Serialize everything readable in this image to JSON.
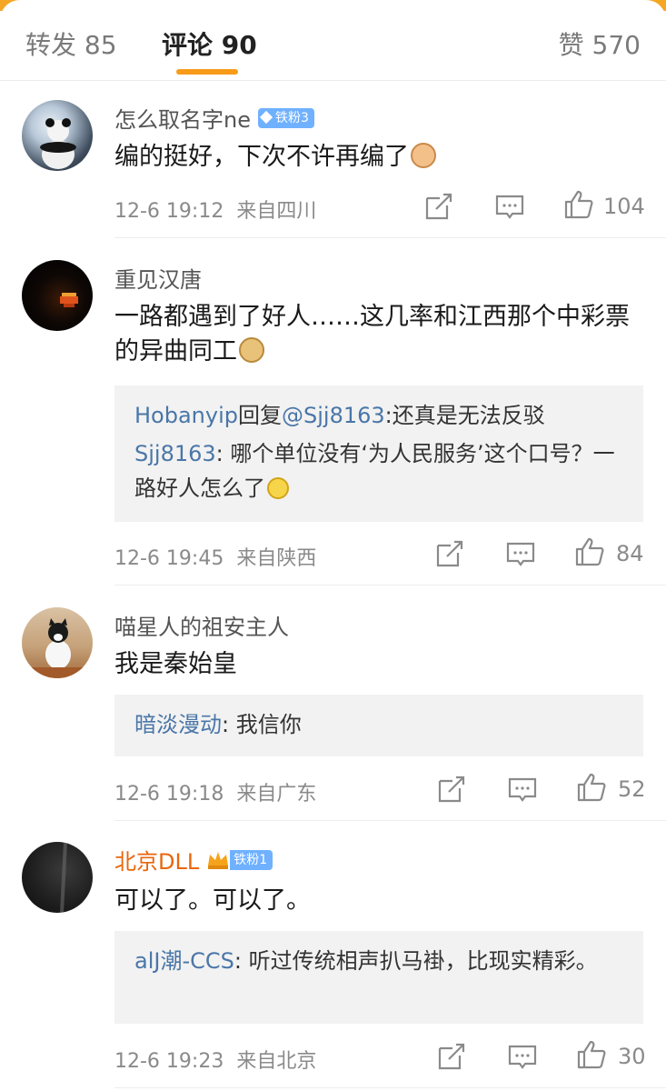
{
  "tabs": {
    "repost": "转发 85",
    "comments": "评论 90",
    "likes": "赞 570"
  },
  "comments": [
    {
      "name": "怎么取名字ne",
      "badge": "铁粉3",
      "text": "编的挺好，下次不许再编了",
      "emoji": "cat-emoji",
      "time": "12-6 19:12",
      "from": "来自四川",
      "likes": "104"
    },
    {
      "name": "重见汉唐",
      "text": "一路都遇到了好人……这几率和江西那个中彩票的异曲同工",
      "emoji": "doge-emoji",
      "replies": [
        {
          "user": "Hobanyip",
          "mid": "回复",
          "target": "@Sjj8163",
          "text": ":还真是无法反驳"
        },
        {
          "user": "Sjj8163",
          "text": ": 哪个单位没有‘为人民服务’这个口号？一路好人怎么了"
        }
      ],
      "time": "12-6 19:45",
      "from": "来自陕西",
      "likes": "84"
    },
    {
      "name": "喵星人的祖安主人",
      "text": "我是秦始皇",
      "replies": [
        {
          "user": "暗淡漫动",
          "text": ": 我信你"
        }
      ],
      "time": "12-6 19:18",
      "from": "来自广东",
      "likes": "52"
    },
    {
      "name": "北京DLL",
      "badge": "铁粉1",
      "text": "可以了。可以了。",
      "replies": [
        {
          "user": "alJ潮-CCS",
          "text": ": 听过传统相声扒马褂，比现实精彩。"
        }
      ],
      "time": "12-6 19:23",
      "from": "来自北京",
      "likes": "30"
    }
  ],
  "colors": {
    "accent": "#f79b19",
    "link": "#4a76a8",
    "vip_name": "#e8660c",
    "badge": "#6fb1ff"
  }
}
